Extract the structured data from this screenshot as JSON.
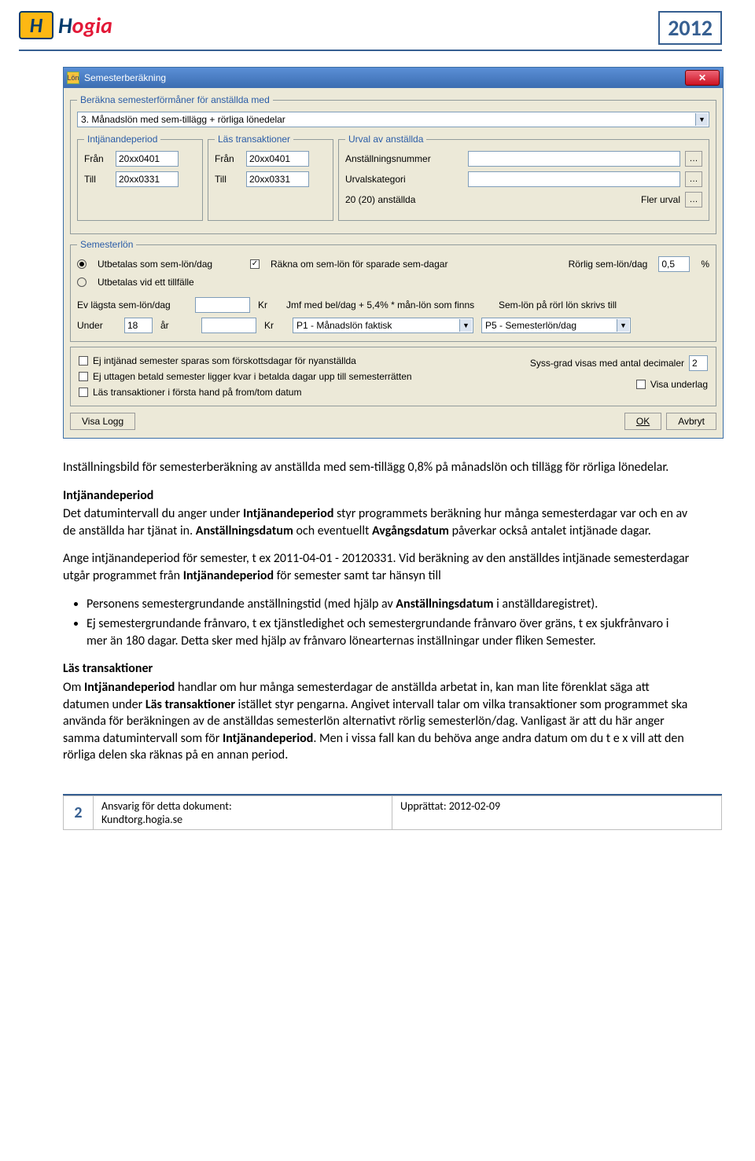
{
  "header": {
    "brand_letter": "H",
    "brand1": "H",
    "brand2": "ogia",
    "year": "2012"
  },
  "window": {
    "title": "Semesterberäkning",
    "fs_berakna": {
      "legend": "Beräkna semesterförmåner för anställda med",
      "selected": "3.   Månadslön med sem-tillägg + rörliga lönedelar"
    },
    "intjanande": {
      "legend": "Intjänandeperiod",
      "fran_label": "Från",
      "fran": "20xx0401",
      "till_label": "Till",
      "till": "20xx0331"
    },
    "las": {
      "legend": "Läs transaktioner",
      "fran_label": "Från",
      "fran": "20xx0401",
      "till_label": "Till",
      "till": "20xx0331"
    },
    "urval": {
      "legend": "Urval av anställda",
      "anst_label": "Anställningsnummer",
      "kat_label": "Urvalskategori",
      "count": "20 (20) anställda",
      "fler": "Fler urval"
    },
    "semlon": {
      "legend": "Semesterlön",
      "r1": "Utbetalas som sem-lön/dag",
      "r2": "Utbetalas vid ett tillfälle",
      "cb_rakna": "Räkna om sem-lön för sparade sem-dagar",
      "rorlig_label": "Rörlig sem-lön/dag",
      "rorlig_val": "0,5",
      "rorlig_unit": "%",
      "ev_label": "Ev lägsta sem-lön/dag",
      "kr": "Kr",
      "under_label": "Under",
      "under_val": "18",
      "ar": "år",
      "jmf_label": "Jmf med bel/dag + 5,4% * mån-lön som finns",
      "dd1": "P1 - Månadslön faktisk",
      "semlon_rorl": "Sem-lön på rörl lön skrivs till",
      "dd2": "P5 - Semesterlön/dag"
    },
    "extras": {
      "c1": "Ej intjänad semester sparas som förskottsdagar för nyanställda",
      "c2": "Ej uttagen betald semester ligger kvar i betalda dagar upp till semesterrätten",
      "c3": "Läs transaktioner i första hand på from/tom datum",
      "dec_label": "Syss-grad visas med antal decimaler",
      "dec_val": "2",
      "visa_underlag": "Visa underlag"
    },
    "buttons": {
      "visa_logg": "Visa Logg",
      "ok": "OK",
      "avbryt": "Avbryt"
    }
  },
  "doc": {
    "p1": "Inställningsbild för semesterberäkning av anställda med sem-tillägg 0,8% på månadslön och tillägg för rörliga lönedelar.",
    "h_intj": "Intjänandeperiod",
    "p_intj1": "Det datumintervall du anger under Intjänandeperiod styr programmets beräkning hur många semesterdagar var och en av de anställda har tjänat in. Anställningsdatum och eventuellt Avgångsdatum påverkar också antalet intjänade dagar.",
    "p_intj2a": "Ange intjänandeperiod för semester, t ex 2011-04-01 - 20120331. Vid beräkning av den anställdes intjänade semesterdagar utgår programmet från ",
    "p_intj2b": " för semester samt tar hänsyn till",
    "li1a": "Personens semestergrundande anställningstid (med hjälp av ",
    "li1b": " i anställdaregistret).",
    "li2": "Ej semestergrundande frånvaro, t ex tjänstledighet och semestergrundande frånvaro över gräns, t ex sjukfrånvaro i mer än 180 dagar. Detta sker med hjälp av frånvaro lönearternas inställningar under fliken Semester.",
    "h_las": "Läs transaktioner",
    "p_las": "Om Intjänandeperiod handlar om hur många semesterdagar de anställda arbetat in, kan man lite förenklat säga att datumen under Läs transaktioner istället styr pengarna. Angivet intervall talar om vilka transaktioner som programmet ska använda för beräkningen av de anställdas semesterlön alternativt rörlig semesterlön/dag. Vanligast är att du här anger samma datumintervall som för Intjänandeperiod. Men i vissa fall kan du behöva ange andra datum om du t e x vill att den rörliga delen ska räknas på en annan period.",
    "b_intj": "Intjänandeperiod",
    "b_anst": "Anställningsdatum",
    "b_avg": "Avgångsdatum",
    "b_anstdat": "Anställningsdatum",
    "b_las": "Läs transaktioner"
  },
  "footer": {
    "page": "2",
    "resp_label": "Ansvarig för detta dokument:",
    "resp_val": "Kundtorg.hogia.se",
    "upp_label": "Upprättat: ",
    "upp_val": "2012-02-09"
  }
}
